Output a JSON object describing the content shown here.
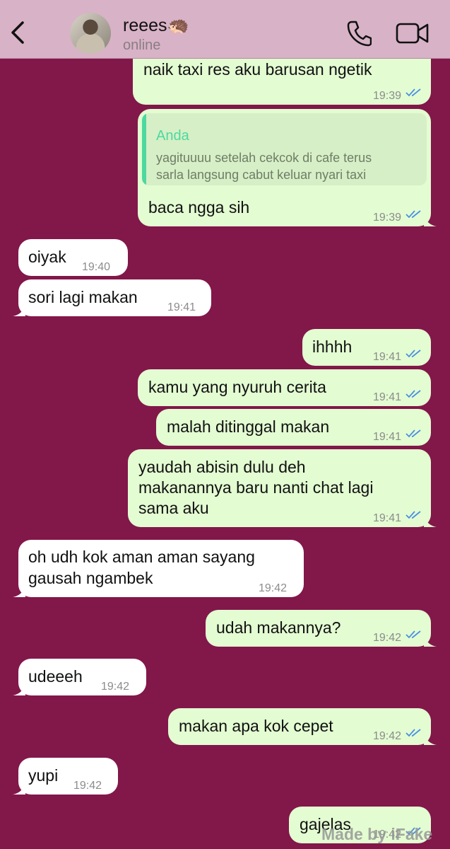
{
  "header": {
    "contact_name": "reees🦔",
    "status": "online"
  },
  "messages": [
    {
      "dir": "out",
      "text": "naik taxi res aku barusan ngetik",
      "time": "19:39"
    },
    {
      "dir": "out",
      "quote_author": "Anda",
      "quote_lines": [
        "yagituuuu setelah cekcok di cafe terus",
        "sarla langsung cabut keluar nyari taxi"
      ],
      "text": "baca ngga sih",
      "time": "19:39"
    },
    {
      "dir": "in",
      "text": "oiyak",
      "time": "19:40"
    },
    {
      "dir": "in",
      "text": "sori lagi makan",
      "time": "19:41"
    },
    {
      "dir": "out",
      "text": "ihhhh",
      "time": "19:41"
    },
    {
      "dir": "out",
      "text": "kamu yang nyuruh cerita",
      "time": "19:41"
    },
    {
      "dir": "out",
      "text": "malah ditinggal makan",
      "time": "19:41"
    },
    {
      "dir": "out",
      "lines": [
        "yaudah abisin dulu deh",
        "makanannya baru nanti chat lagi",
        "sama aku"
      ],
      "time": "19:41"
    },
    {
      "dir": "in",
      "lines": [
        "oh udh kok aman aman sayang",
        "gausah ngambek"
      ],
      "time": "19:42"
    },
    {
      "dir": "out",
      "text": "udah makannya?",
      "time": "19:42"
    },
    {
      "dir": "in",
      "text": "udeeeh",
      "time": "19:42"
    },
    {
      "dir": "out",
      "text": "makan apa kok cepet",
      "time": "19:42"
    },
    {
      "dir": "in",
      "text": "yupi",
      "time": "19:42"
    },
    {
      "dir": "out",
      "text": "gajelas",
      "time": "19:42"
    }
  ],
  "watermark": "Made by iFake",
  "colors": {
    "chat_background": "#82174a",
    "header_background": "#d8b2c6",
    "outgoing_bubble": "#e3fcd2",
    "incoming_bubble": "#ffffff",
    "read_ticks": "#4a90e2",
    "quote_accent": "#4cd9a0"
  },
  "icons": [
    "back-arrow-icon",
    "phone-icon",
    "video-camera-icon",
    "double-check-icon"
  ]
}
